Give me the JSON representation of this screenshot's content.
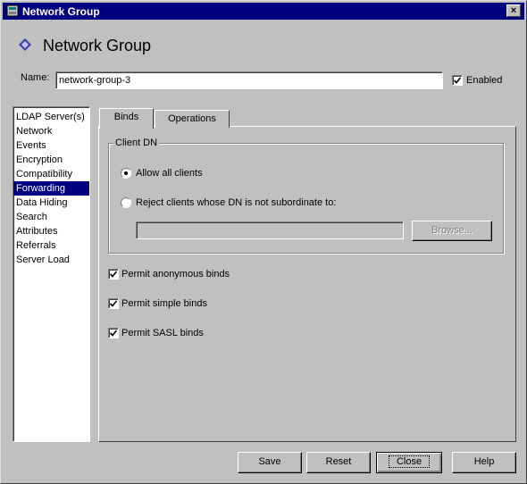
{
  "window": {
    "title": "Network Group",
    "close_glyph": "×"
  },
  "heading": {
    "title": "Network Group",
    "icon": "diamond-icon"
  },
  "name_field": {
    "label": "Name:",
    "value": "network-group-3"
  },
  "enabled": {
    "label": "Enabled",
    "checked": true
  },
  "sidebar": {
    "items": [
      {
        "label": "LDAP Server(s)"
      },
      {
        "label": "Network"
      },
      {
        "label": "Events"
      },
      {
        "label": "Encryption"
      },
      {
        "label": "Compatibility"
      },
      {
        "label": "Forwarding",
        "selected": true
      },
      {
        "label": "Data Hiding"
      },
      {
        "label": "Search"
      },
      {
        "label": "Attributes"
      },
      {
        "label": "Referrals"
      },
      {
        "label": "Server Load"
      }
    ]
  },
  "tabs": [
    {
      "label": "Binds",
      "active": true
    },
    {
      "label": "Operations"
    }
  ],
  "client_dn": {
    "title": "Client DN",
    "allow_label": "Allow all clients",
    "reject_label": "Reject clients whose DN is not subordinate to:",
    "dn_value": "",
    "browse_label": "Browse..."
  },
  "options": {
    "anonymous": "Permit anonymous binds",
    "simple": "Permit simple binds",
    "sasl": "Permit SASL binds"
  },
  "buttons": {
    "save": "Save",
    "reset": "Reset",
    "close": "Close",
    "help": "Help"
  },
  "colors": {
    "title_bar": "#000080",
    "selection": "#000080",
    "face": "#c0c0c0"
  }
}
